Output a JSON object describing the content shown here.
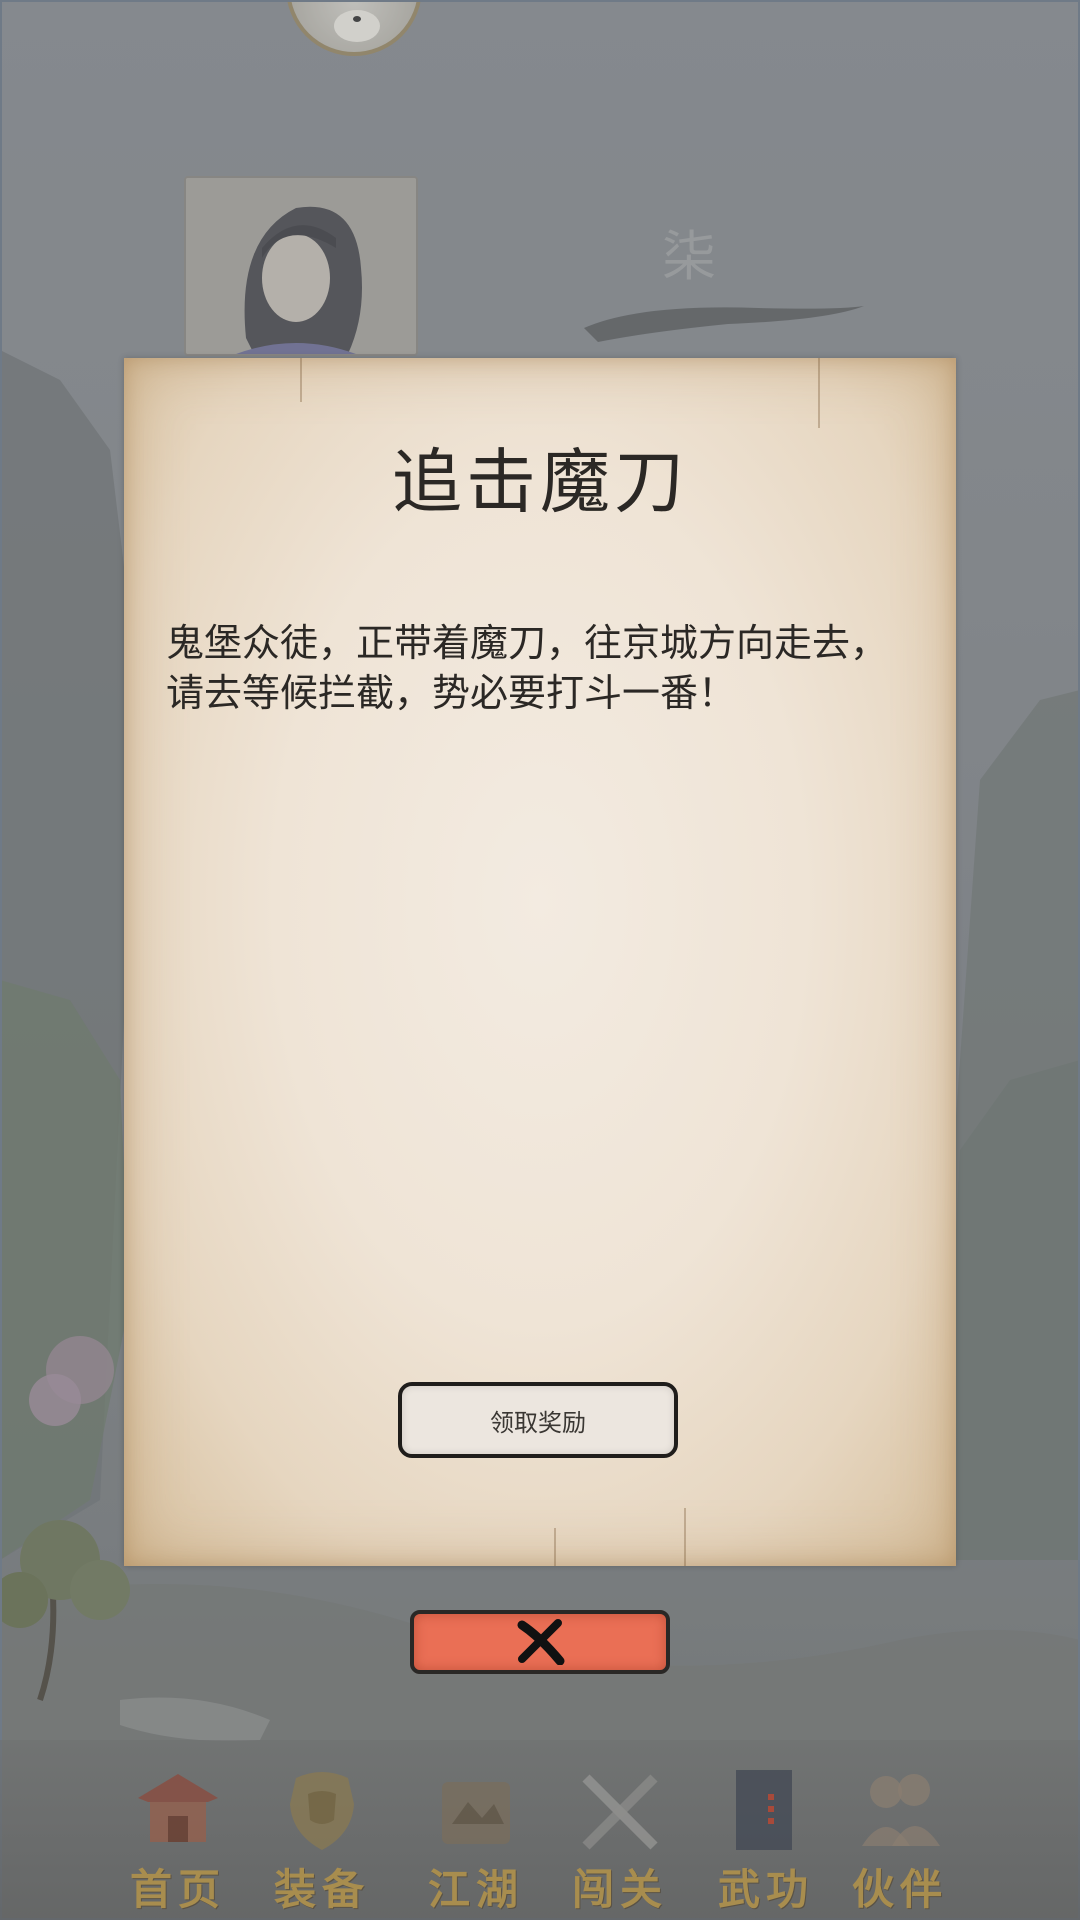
{
  "background": {
    "rank_glyph": "柒"
  },
  "modal": {
    "title": "追击魔刀",
    "description": "鬼堡众徒，正带着魔刀，往京城方向走去，请去等候拦截，势必要打斗一番！",
    "claim_button_label": "领取奖励",
    "close_icon": "x-mark-icon"
  },
  "bottom_nav": {
    "items": [
      {
        "label": "首页",
        "icon": "pagoda-icon"
      },
      {
        "label": "装备",
        "icon": "armor-icon"
      },
      {
        "label": "江湖",
        "icon": "scroll-map-icon"
      },
      {
        "label": "闯关",
        "icon": "crossed-swords-icon"
      },
      {
        "label": "武功",
        "icon": "martial-book-icon"
      },
      {
        "label": "伙伴",
        "icon": "companions-icon"
      }
    ]
  },
  "colors": {
    "parchment": "#efe4d6",
    "close_button": "#ea6f55",
    "nav_label": "#a88d4e",
    "text": "#2b2825"
  }
}
